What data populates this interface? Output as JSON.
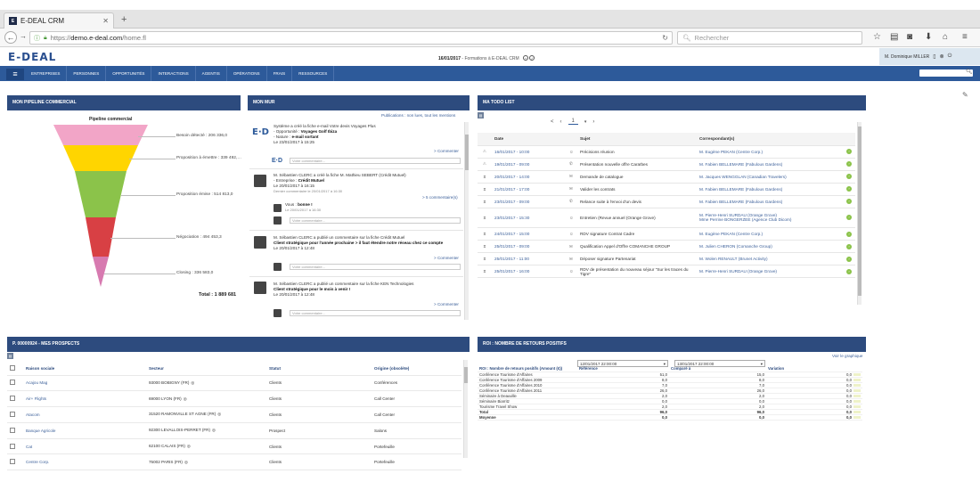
{
  "browser": {
    "tab_title": "E-DEAL CRM",
    "url_scheme": "https://",
    "url_host": "demo.e-deal.com",
    "url_path": "/home.fl",
    "search_placeholder": "Rechercher"
  },
  "app": {
    "logo": "E-DEAL",
    "header_date": "16/01/2017",
    "header_sep": " - ",
    "header_text": "Formations à E-DEAL CRM",
    "user_name": "M. Dominique MILLER"
  },
  "menu": {
    "items": [
      "Entreprises",
      "Personnes",
      "Opportunités",
      "Interactions",
      "Agentis",
      "Opérations",
      "Frais",
      "Ressources"
    ]
  },
  "pipeline": {
    "header": "Mon pipeline commercial",
    "title": "Pipeline commercial",
    "stages": [
      {
        "label": "Besoin détecté : 206 336,0",
        "color": "#f2a5c7"
      },
      {
        "label": "Proposition à émettre : 339 492,…",
        "color": "#ffd500"
      },
      {
        "label": "Proposition émise : 514 813,0",
        "color": "#8bc34a"
      },
      {
        "label": "Négociation : 494 453,3",
        "color": "#d84044"
      },
      {
        "label": "Closing : 336 583,0",
        "color": "#d77ab0"
      }
    ],
    "total": "Total : 1 889 681"
  },
  "wall": {
    "header": "Mon mur",
    "filter_links": "Publications : non lues, tout les mentions",
    "post1": {
      "line1": "Système a créé la fiche e-mail Votre devis Voyages Plus",
      "line2_label": "- Opportunité : ",
      "line2_value": "Voyages Golf Ibiza",
      "line3_label": "- Nature : ",
      "line3_value": "e-mail sortant",
      "date": "Le 23/01/2017 à 15:25",
      "comment_link": "> Commenter",
      "comment_placeholder": "Votre commentaire..."
    },
    "post2": {
      "line1": "M. Sébastien CLERC a créé la fiche M. Mathieu SEBERT (Crédit Mutuel)",
      "line2_label": "- Entreprise : ",
      "line2_value": "Crédit Mutuel",
      "date": "Le 20/01/2017 à 16:15",
      "sub_info": "Dernier commentaire le 20/01/2017 à 16:30",
      "count_link": "> 5 commentaire(s)",
      "reply_user": "Vous :",
      "reply_text": "bonne !",
      "reply_date": "Le 20/01/2017 à 16:30",
      "comment_placeholder": "Votre commentaire..."
    },
    "post3": {
      "line1": "M. Sébastien CLERC a publié un commentaire sur la fiche Crédit Mutuel",
      "line2": "Client stratégique pour l'année prochaine > il faut étendre notre réseau chez ce compte",
      "date": "Le 20/01/2017 à 12:48",
      "comment_link": "> Commenter",
      "comment_placeholder": "Votre commentaire..."
    },
    "post4": {
      "line1": "M. Sébastien CLERC a publié un commentaire sur la fiche KEN Technologies",
      "line2": "Client stratégique pour le mois à venir !",
      "date": "Le 20/01/2017 à 12:48",
      "comment_link": "> Commenter",
      "comment_placeholder": "Votre commentaire..."
    }
  },
  "todo": {
    "header": "Ma todo list",
    "pager": {
      "page": "1"
    },
    "columns": [
      "",
      "Date",
      "",
      "Sujet",
      "Correspondant(s)",
      ""
    ],
    "rows": [
      {
        "icon": "⚠",
        "date": "16/01/2017 - 10:00",
        "type": "☺",
        "subject": "Précisions réunion",
        "contact": "M. Eugène PEKAN (Centre Corp.)"
      },
      {
        "icon": "⚠",
        "date": "19/01/2017 - 09:00",
        "type": "✆",
        "subject": "Présentation nouvelle offre Caraïbes",
        "contact": "M. Fabien BELLEMARE (Fabulous Gardens)"
      },
      {
        "icon": "⧗",
        "date": "20/01/2017 - 14:00",
        "type": "✉",
        "subject": "Demande de catalogue",
        "contact": "M. Jacques WENGGLAN (Canadian Travelers)"
      },
      {
        "icon": "⧗",
        "date": "21/01/2017 - 17:00",
        "type": "✉",
        "subject": "Valider les contrats",
        "contact": "M. Fabien BELLEMARE (Fabulous Gardens)"
      },
      {
        "icon": "⧗",
        "date": "23/01/2017 - 09:00",
        "type": "✆",
        "subject": "Relance suite à l'envoi d'un devis",
        "contact": "M. Fabien BELLEMARE (Fabulous Gardens)"
      },
      {
        "icon": "⧗",
        "date": "23/01/2017 - 15:30",
        "type": "☺",
        "subject": "Entretien (Revue annuel (Orange Grove)",
        "contact": "M. Pierre-Henri SURDAU (Orange Grove)",
        "contact2": "Mme Perrine BONGERZEE (Agence Club Dicom)"
      },
      {
        "icon": "⧗",
        "date": "24/01/2017 - 15:00",
        "type": "☺",
        "subject": "RDV signature Contrat Cadre",
        "contact": "M. Eugène PEKAN (Centre Corp.)"
      },
      {
        "icon": "⧗",
        "date": "25/01/2017 - 09:00",
        "type": "✉",
        "subject": "Qualification Appel d'Offre COMANCHE GROUP",
        "contact": "M. Julien CHERON (Comanche Group)"
      },
      {
        "icon": "⧗",
        "date": "25/01/2017 - 11:00",
        "type": "✉",
        "subject": "Déposer signature Partenariat",
        "contact": "M. Wolen RENAULT (Brunet Activity)"
      },
      {
        "icon": "⧗",
        "date": "25/01/2017 - 16:00",
        "type": "☺",
        "subject": "RDV de présentation du nouveau séjour \"Sur les traces du Tigre\"",
        "contact": "M. Pierre-Henri SURDAU (Orange Grove)"
      }
    ]
  },
  "prospects": {
    "header": "P. 00000924 - Mes prospects",
    "columns": [
      "Raison sociale",
      "Secteur",
      "Statut",
      "Origine (obsolète)"
    ],
    "rows": [
      {
        "name": "Acajou Mag",
        "sector": "93000 BOBIGNY (FR)",
        "status": "Clients",
        "origin": "Conférences"
      },
      {
        "name": "Air+ Flights",
        "sector": "69000 LYON (FR)",
        "status": "Clients",
        "origin": "Call Center"
      },
      {
        "name": "Atacom",
        "sector": "31520 RAMONVILLE ST AGNE (FR)",
        "status": "Clients",
        "origin": "Call Center"
      },
      {
        "name": "Banque Agricole",
        "sector": "92300 LEVALLOIS-PERRET (FR)",
        "status": "Prospect",
        "origin": "Salons"
      },
      {
        "name": "Cat",
        "sector": "62100 CALAIS (FR)",
        "status": "Clients",
        "origin": "Portefeuille"
      },
      {
        "name": "Centre Corp.",
        "sector": "75002 PARIS (FR)",
        "status": "Clients",
        "origin": "Portefeuille"
      }
    ]
  },
  "roi": {
    "header": "ROI : Nombre de retours positifs",
    "chart_link": "Voir le graphique",
    "date_ref": "12/01/2017 22:00:00",
    "date_cmp": "13/01/2017 22:00:00",
    "columns": [
      "ROI : Nombre de retours positifs (Amount (€))",
      "Référence",
      "Comparé à",
      "Variation"
    ],
    "rows": [
      {
        "label": "Conférence Tourisme d'Affaires",
        "ref": "51,0",
        "cmp": "15,0",
        "var": "0,0"
      },
      {
        "label": "Conférence Tourisme d'Affaires 2009",
        "ref": "8,0",
        "cmp": "8,0",
        "var": "0,0"
      },
      {
        "label": "Conférence Tourisme d'Affaires 2010",
        "ref": "7,0",
        "cmp": "7,0",
        "var": "0,0"
      },
      {
        "label": "Conférence Tourisme d'Affaires 2011",
        "ref": "26,0",
        "cmp": "26,0",
        "var": "0,0"
      },
      {
        "label": "Séminaire à Deauville",
        "ref": "2,0",
        "cmp": "2,0",
        "var": "0,0"
      },
      {
        "label": "Séminaire Biarritz",
        "ref": "0,0",
        "cmp": "0,0",
        "var": "0,0"
      },
      {
        "label": "Tourisme Travel Show",
        "ref": "2,0",
        "cmp": "2,0",
        "var": "0,0"
      }
    ],
    "total": {
      "label": "Total",
      "ref": "96,0",
      "cmp": "96,0",
      "var": "0,0"
    },
    "average": {
      "label": "Moyenne",
      "ref": "0,0",
      "cmp": "0,0",
      "var": "0,0"
    }
  },
  "colors": {
    "nav": "#2d5a9a",
    "panel_header": "#2d4b7e",
    "link": "#3b5f99",
    "accent_green": "#8bc34a"
  }
}
